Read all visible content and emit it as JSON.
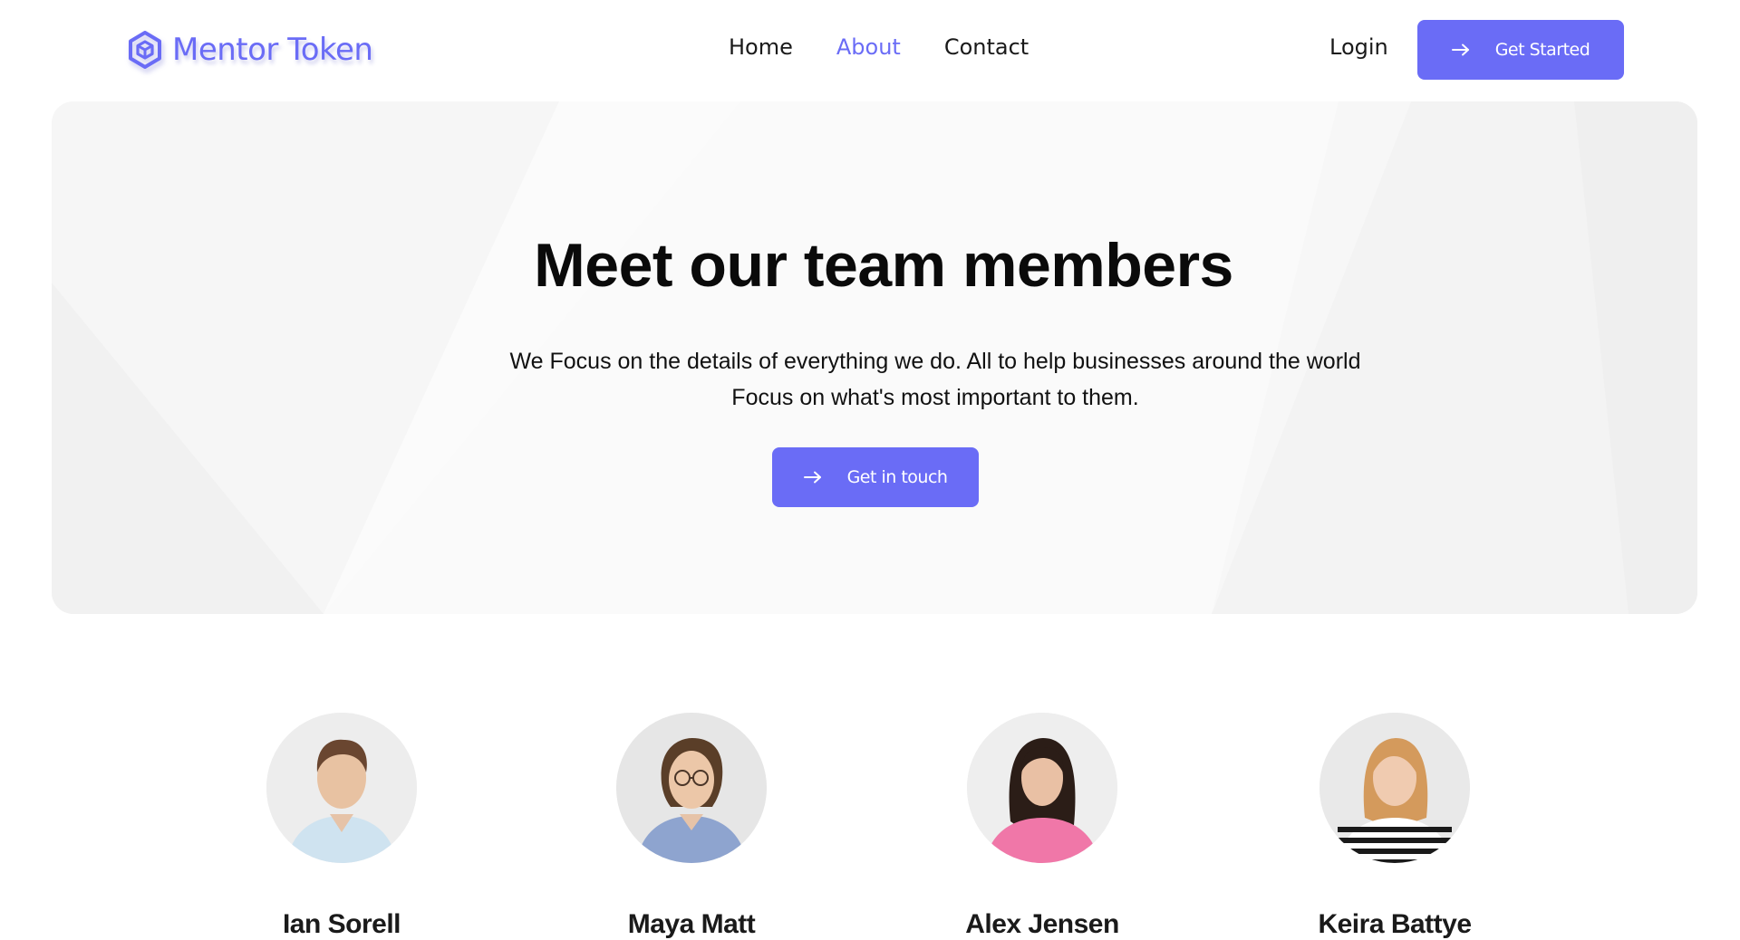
{
  "brand": {
    "name": "Mentor Token",
    "icon": "hexagon-cube-logo-icon",
    "color": "#6a6cf6"
  },
  "nav": {
    "items": [
      {
        "label": "Home",
        "active": false
      },
      {
        "label": "About",
        "active": true
      },
      {
        "label": "Contact",
        "active": false
      }
    ],
    "login_label": "Login",
    "cta_label": "Get Started"
  },
  "hero": {
    "title": "Meet our team members",
    "subtitle_line1": "We Focus on the details of everything we do. All to help businesses around the world",
    "subtitle_line2": "Focus on what's most important to them.",
    "cta_label": "Get in touch"
  },
  "team": {
    "members": [
      {
        "name": "Ian Sorell",
        "avatar": "man-light-blue-shirt-photo"
      },
      {
        "name": "Maya Matt",
        "avatar": "woman-glasses-striped-shirt-photo"
      },
      {
        "name": "Alex Jensen",
        "avatar": "woman-pink-sweater-photo"
      },
      {
        "name": "Keira Battye",
        "avatar": "woman-striped-top-photo"
      }
    ]
  },
  "colors": {
    "accent": "#6a6cf6",
    "hero_background": "#fafafa",
    "text": "#111111"
  }
}
